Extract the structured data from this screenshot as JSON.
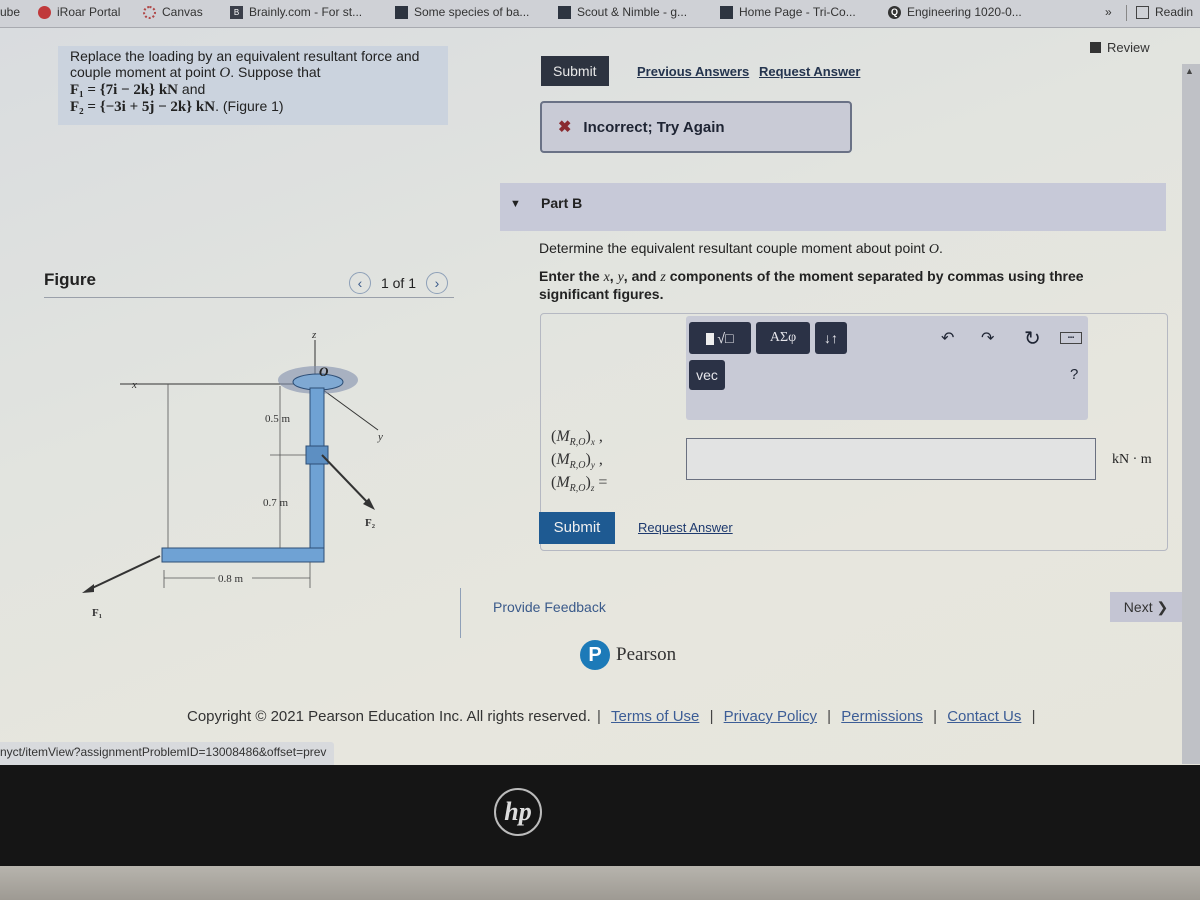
{
  "browser": {
    "bookmarks": [
      {
        "label": "ube",
        "icon": "youtube-icon"
      },
      {
        "label": "iRoar Portal",
        "icon": "iroar-icon"
      },
      {
        "label": "Canvas",
        "icon": "canvas-icon"
      },
      {
        "label": "Brainly.com - For st...",
        "icon": "brainly-icon"
      },
      {
        "label": "Some species of ba...",
        "icon": "page-icon"
      },
      {
        "label": "Scout & Nimble - g...",
        "icon": "page-icon"
      },
      {
        "label": "Home Page - Tri-Co...",
        "icon": "page-icon"
      },
      {
        "label": "Engineering 1020-0...",
        "icon": "quizlet-icon"
      }
    ],
    "more_label": "»",
    "reading_list_label": "Readin",
    "status_url": "nyct/itemView?assignmentProblemID=13008486&offset=prev"
  },
  "header": {
    "review_label": "Review"
  },
  "problem": {
    "intro": "Replace the loading by an equivalent resultant force and couple moment at point",
    "point": "O",
    "suppose": ". Suppose that",
    "f1": "F₁ = {7i − 2k} kN",
    "f1_suffix": " and",
    "f2": "F₂ = {−3i + 5j − 2k} kN",
    "f2_suffix": ". (Figure 1)"
  },
  "figure": {
    "title": "Figure",
    "pager": "1 of 1",
    "labels": {
      "z": "z",
      "x": "x",
      "y": "y",
      "O": "O",
      "d1": "0.5 m",
      "d2": "0.7 m",
      "d3": "0.8 m",
      "F1": "F₁",
      "F2": "F₂"
    }
  },
  "part_a": {
    "submit_label": "Submit",
    "previous_answers_label": "Previous Answers",
    "request_answer_label": "Request Answer",
    "feedback": "Incorrect; Try Again"
  },
  "part_b": {
    "label": "Part B",
    "question_prefix": "Determine the equivalent resultant couple moment about point",
    "question_point": "O",
    "question_suffix": ".",
    "instructions": {
      "a": "Enter the ",
      "x": "x",
      "b": ", ",
      "y": "y",
      "c": ", and ",
      "z": "z",
      "d": " components of the moment separated by commas using three significant figures."
    },
    "toolbar": {
      "templates_label": "√□",
      "greek_label": "ΑΣφ",
      "arrows_label": "↓↑",
      "vec_label": "vec",
      "help_label": "?"
    },
    "input_labels": [
      "(M",
      "R,O",
      ")x ,",
      ")y ,",
      ")z ="
    ],
    "input_value": "",
    "unit": "kN · m",
    "submit_label": "Submit",
    "request_answer_label": "Request Answer"
  },
  "footer": {
    "provide_feedback": "Provide Feedback",
    "next_label": "Next ❯",
    "pearson_name": "Pearson",
    "copyright": "Copyright © 2021 Pearson Education Inc. All rights reserved.",
    "links": [
      "Terms of Use",
      "Privacy Policy",
      "Permissions",
      "Contact Us"
    ]
  },
  "device": {
    "logo": "hp"
  }
}
